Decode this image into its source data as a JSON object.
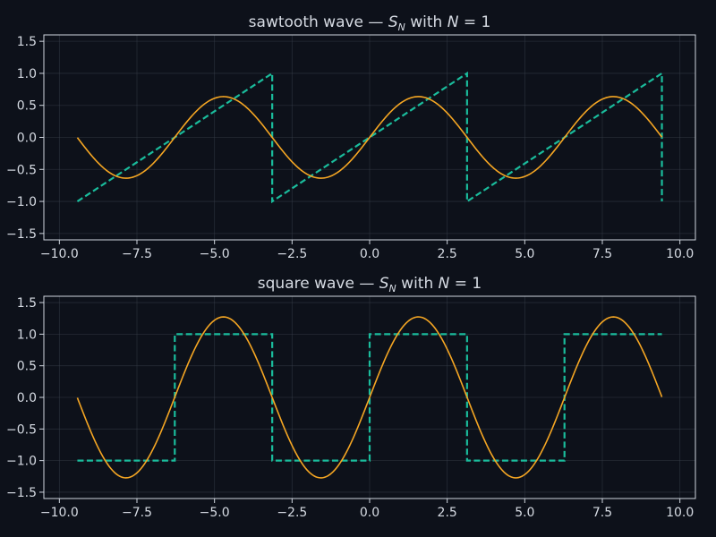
{
  "chart_data": [
    {
      "type": "line",
      "title": "sawtooth wave — S_N with N = 1",
      "title_parts": {
        "prefix": "sawtooth wave — ",
        "s": "S",
        "sub": "N",
        "mid": " with ",
        "n": "N",
        "eq": " = 1"
      },
      "xlim": [
        -10.5,
        10.5
      ],
      "ylim": [
        -1.6,
        1.6
      ],
      "x_ticks": [
        -10.0,
        -7.5,
        -5.0,
        -2.5,
        0.0,
        2.5,
        5.0,
        7.5,
        10.0
      ],
      "x_tick_labels": [
        "−10.0",
        "−7.5",
        "−5.0",
        "−2.5",
        "0.0",
        "2.5",
        "5.0",
        "7.5",
        "10.0"
      ],
      "y_ticks": [
        1.5,
        1.0,
        0.5,
        0.0,
        -0.5,
        -1.0,
        -1.5
      ],
      "y_tick_labels": [
        "1.5",
        "1.0",
        "0.5",
        "0.0",
        "−0.5",
        "−1.0",
        "−1.5"
      ],
      "grid": true,
      "series": [
        {
          "style": "dashed",
          "color": "#1abc9c",
          "x": [
            -9.42,
            -3.14,
            -3.14,
            3.14,
            3.14,
            9.42,
            9.42
          ],
          "y": [
            -1.0,
            1.0,
            -1.0,
            1.0,
            -1.0,
            1.0,
            -1.0
          ]
        },
        {
          "style": "solid",
          "color": "#f5a623",
          "function": "(2/pi)*sin(x)",
          "amplitude": 0.6366,
          "x_range": [
            -9.42,
            9.42
          ]
        }
      ]
    },
    {
      "type": "line",
      "title": "square wave — S_N with N = 1",
      "title_parts": {
        "prefix": "square wave — ",
        "s": "S",
        "sub": "N",
        "mid": " with ",
        "n": "N",
        "eq": " = 1"
      },
      "xlim": [
        -10.5,
        10.5
      ],
      "ylim": [
        -1.6,
        1.6
      ],
      "x_ticks": [
        -10.0,
        -7.5,
        -5.0,
        -2.5,
        0.0,
        2.5,
        5.0,
        7.5,
        10.0
      ],
      "x_tick_labels": [
        "−10.0",
        "−7.5",
        "−5.0",
        "−2.5",
        "0.0",
        "2.5",
        "5.0",
        "7.5",
        "10.0"
      ],
      "y_ticks": [
        1.5,
        1.0,
        0.5,
        0.0,
        -0.5,
        -1.0,
        -1.5
      ],
      "y_tick_labels": [
        "1.5",
        "1.0",
        "0.5",
        "0.0",
        "−0.5",
        "−1.0",
        "−1.5"
      ],
      "grid": true,
      "series": [
        {
          "style": "dashed",
          "color": "#1abc9c",
          "x": [
            -9.42,
            -6.28,
            -6.28,
            -3.14,
            -3.14,
            0.0,
            0.0,
            3.14,
            3.14,
            6.28,
            6.28,
            9.42
          ],
          "y": [
            -1.0,
            -1.0,
            1.0,
            1.0,
            -1.0,
            -1.0,
            1.0,
            1.0,
            -1.0,
            -1.0,
            1.0,
            1.0
          ]
        },
        {
          "style": "solid",
          "color": "#f5a623",
          "function": "(4/pi)*sin(x)",
          "amplitude": 1.2732,
          "x_range": [
            -9.42,
            9.42
          ]
        }
      ]
    }
  ]
}
